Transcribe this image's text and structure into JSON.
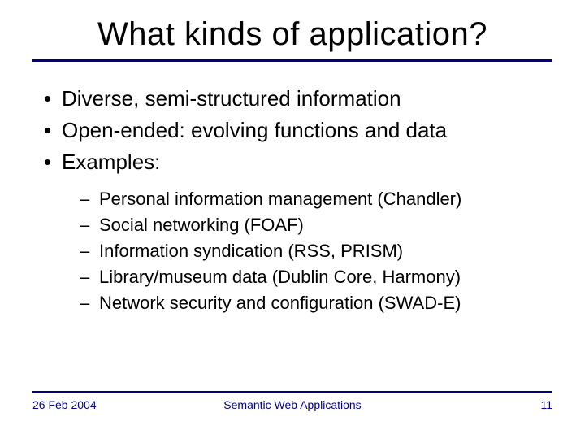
{
  "title": "What kinds of application?",
  "bullets": {
    "b0": "Diverse, semi-structured information",
    "b1": "Open-ended: evolving functions and data",
    "b2": "Examples:"
  },
  "examples": {
    "e0": "Personal information management (Chandler)",
    "e1": "Social networking (FOAF)",
    "e2": "Information syndication (RSS, PRISM)",
    "e3": "Library/museum data (Dublin Core, Harmony)",
    "e4": "Network security and configuration (SWAD-E)"
  },
  "footer": {
    "date": "26 Feb 2004",
    "title": "Semantic Web Applications",
    "page": "11"
  }
}
